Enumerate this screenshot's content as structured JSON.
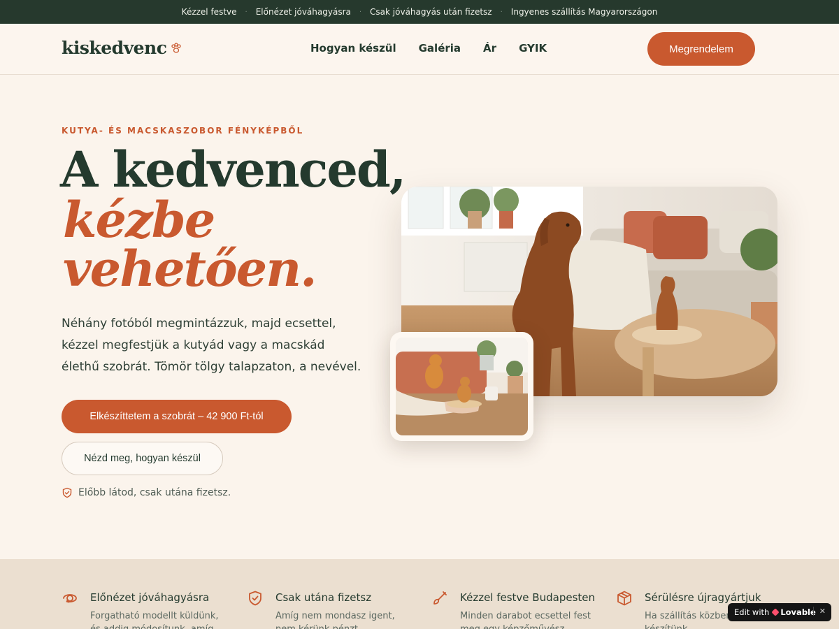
{
  "topbar": {
    "items": [
      "Kézzel festve",
      "Előnézet jóváhagyásra",
      "Csak jóváhagyás után fizetsz",
      "Ingyenes szállítás Magyarországon"
    ],
    "separator": "·"
  },
  "header": {
    "logo": "kiskedvenc",
    "logo_icon": "paw-icon",
    "nav": [
      "Hogyan készül",
      "Galéria",
      "Ár",
      "GYIK"
    ],
    "order_button": "Megrendelem"
  },
  "hero": {
    "eyebrow": "KUTYA- ÉS MACSKASZOBOR FÉNYKÉPBŐL",
    "title_line1": "A kedvenced,",
    "title_line2": "kézbe",
    "title_line3": "vehetően.",
    "lead": "Néhány fotóból megmintázzuk, majd ecsettel, kézzel megfestjük a kutyád vagy a macskád élethű szobrát. Tömör tölgy talapzaton, a nevével.",
    "cta_primary": "Elkészíttetem a szobrát – 42 900 Ft-tól",
    "cta_secondary": "Nézd meg, hogyan készül",
    "trust_text": "Előbb látod, csak utána fizetsz.",
    "trust_icon": "shield-check-icon"
  },
  "features": [
    {
      "icon": "rotate-3d-icon",
      "title": "Előnézet jóváhagyásra",
      "desc": "Forgatható modellt küldünk, és addig módosítunk, amíg rá nem"
    },
    {
      "icon": "shield-check-icon",
      "title": "Csak utána fizetsz",
      "desc": "Amíg nem mondasz igent, nem kérünk pénzt."
    },
    {
      "icon": "brush-icon",
      "title": "Kézzel festve Budapesten",
      "desc": "Minden darabot ecsettel fest meg egy képzőművész."
    },
    {
      "icon": "package-icon",
      "title": "Sérülésre újragyártjuk",
      "desc": "Ha szállítás közben b készítünk."
    }
  ],
  "lovable_badge": {
    "prefix": "Edit with",
    "brand": "Lovable",
    "close": "✕"
  },
  "colors": {
    "accent": "#c9592f",
    "dark_green": "#26392d",
    "background": "#fbf4ec",
    "features_bg": "#ebdfd0"
  }
}
